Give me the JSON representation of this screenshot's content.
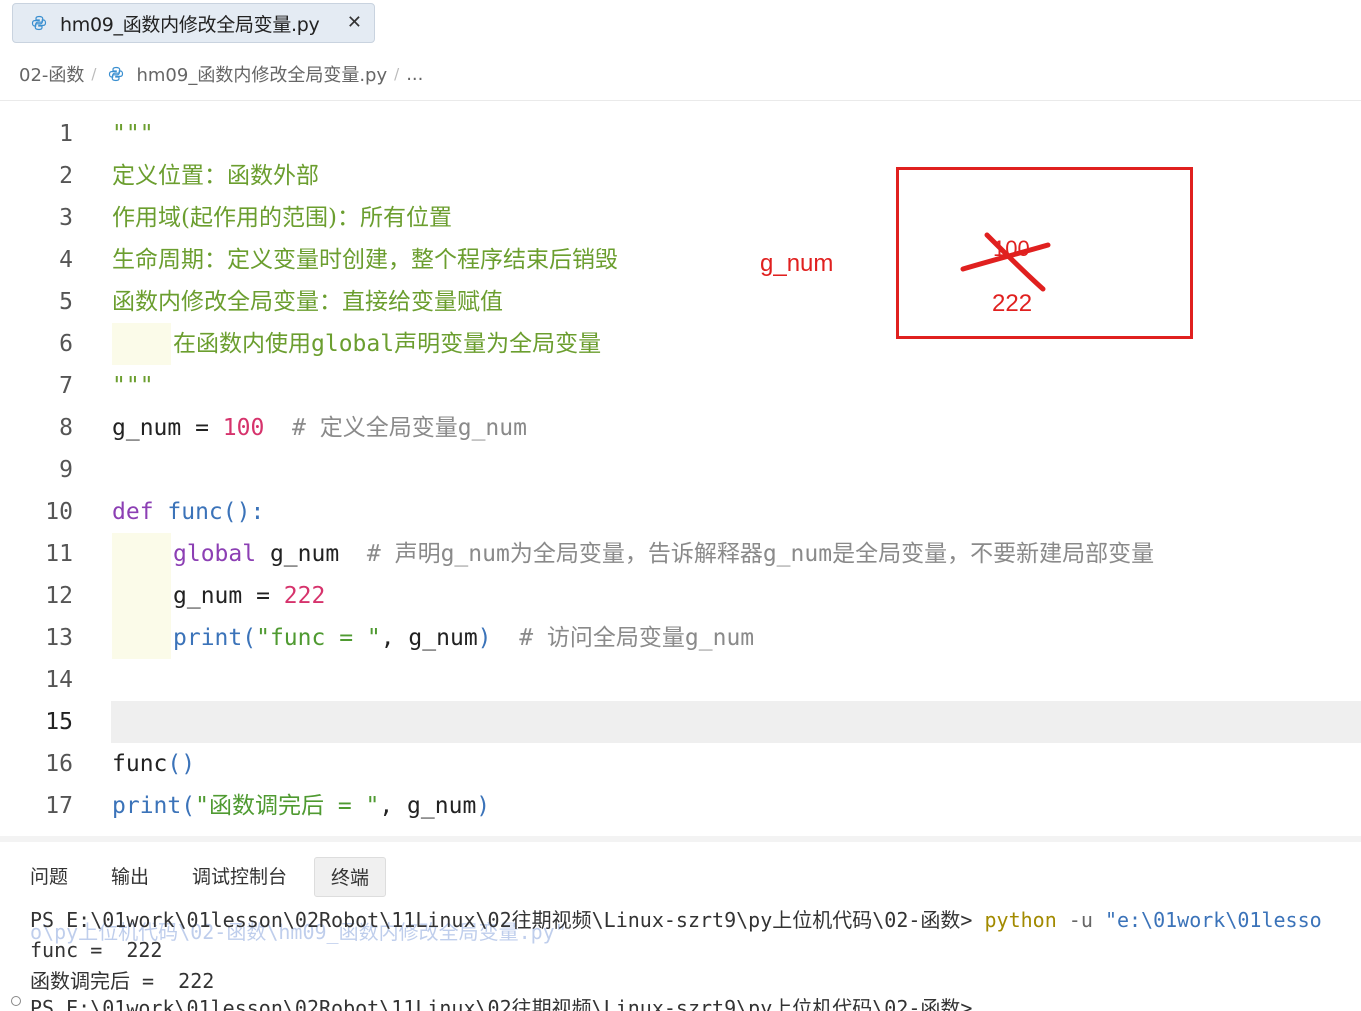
{
  "tab": {
    "title": "hm09_函数内修改全局变量.py",
    "close": "✕"
  },
  "breadcrumb": {
    "folder": "02-函数",
    "sep1": "/",
    "file": "hm09_函数内修改全局变量.py",
    "sep2": "/",
    "more": "..."
  },
  "code": {
    "line_numbers": [
      "1",
      "2",
      "3",
      "4",
      "5",
      "6",
      "7",
      "8",
      "9",
      "10",
      "11",
      "12",
      "13",
      "14",
      "15",
      "16",
      "17"
    ],
    "l1": "\"\"\"",
    "l2": "定义位置：函数外部",
    "l3": "作用域(起作用的范围)：所有位置",
    "l4": "生命周期：定义变量时创建，整个程序结束后销毁",
    "l5": "函数内修改全局变量：直接给变量赋值",
    "l6_pre": "在函数内使用",
    "l6_kw": "global",
    "l6_post": "声明变量为全局变量",
    "l7": "\"\"\"",
    "l8_var": "g_num = ",
    "l8_num": "100",
    "l8_cmt": "  # ",
    "l8_cmt_cn": "定义全局变量",
    "l8_cmt_end": "g_num",
    "l10_kw": "def ",
    "l10_fn": "func",
    "l10_rest": "():",
    "l11_kw": "global",
    "l11_var": " g_num  ",
    "l11_cmt": "# ",
    "l11_cmt_cn1": "声明",
    "l11_cmt_v1": "g_num",
    "l11_cmt_cn2": "为全局变量，告诉解释器",
    "l11_cmt_v2": "g_num",
    "l11_cmt_cn3": "是全局变量，不要新建局部变量",
    "l12_var": "g_num = ",
    "l12_num": "222",
    "l13_fn": "print",
    "l13_p": "(",
    "l13_str": "\"func = \"",
    "l13_rest": ", g_num",
    "l13_p2": ")",
    "l13_cmt": "  # ",
    "l13_cmt_cn": "访问全局变量",
    "l13_cmt_end": "g_num",
    "l16_fn": "func",
    "l16_p": "()",
    "l17_fn": "print",
    "l17_p": "(",
    "l17_q": "\"",
    "l17_str_cn": "函数调完后",
    "l17_str_end": " = \"",
    "l17_rest": ", g_num",
    "l17_p2": ")"
  },
  "annotation": {
    "label": "g_num",
    "old_value": "100",
    "new_value": "222",
    "color": "#e0201f"
  },
  "panel": {
    "tabs": [
      "问题",
      "输出",
      "调试控制台",
      "终端"
    ],
    "active_tab": "终端"
  },
  "terminal": {
    "line1_prompt": "PS E:\\01work\\01lesson\\02Robot\\11Linux\\02往期视频\\Linux-szrt9\\py上位机代码\\02-函数> ",
    "line1_cmd": "python",
    "line1_flag": " -u ",
    "line1_path": "\"e:\\01work\\01lesso",
    "ghost": "o\\py上位机代码\\02-函数\\hm09_函数内修改全局变量.py\"",
    "line2": "func =  222",
    "line3": "函数调完后 =  222",
    "line4": "PS E:\\01work\\01lesson\\02Robot\\11Linux\\02往期视频\\Linux-szrt9\\py上位机代码\\02-函数>"
  }
}
